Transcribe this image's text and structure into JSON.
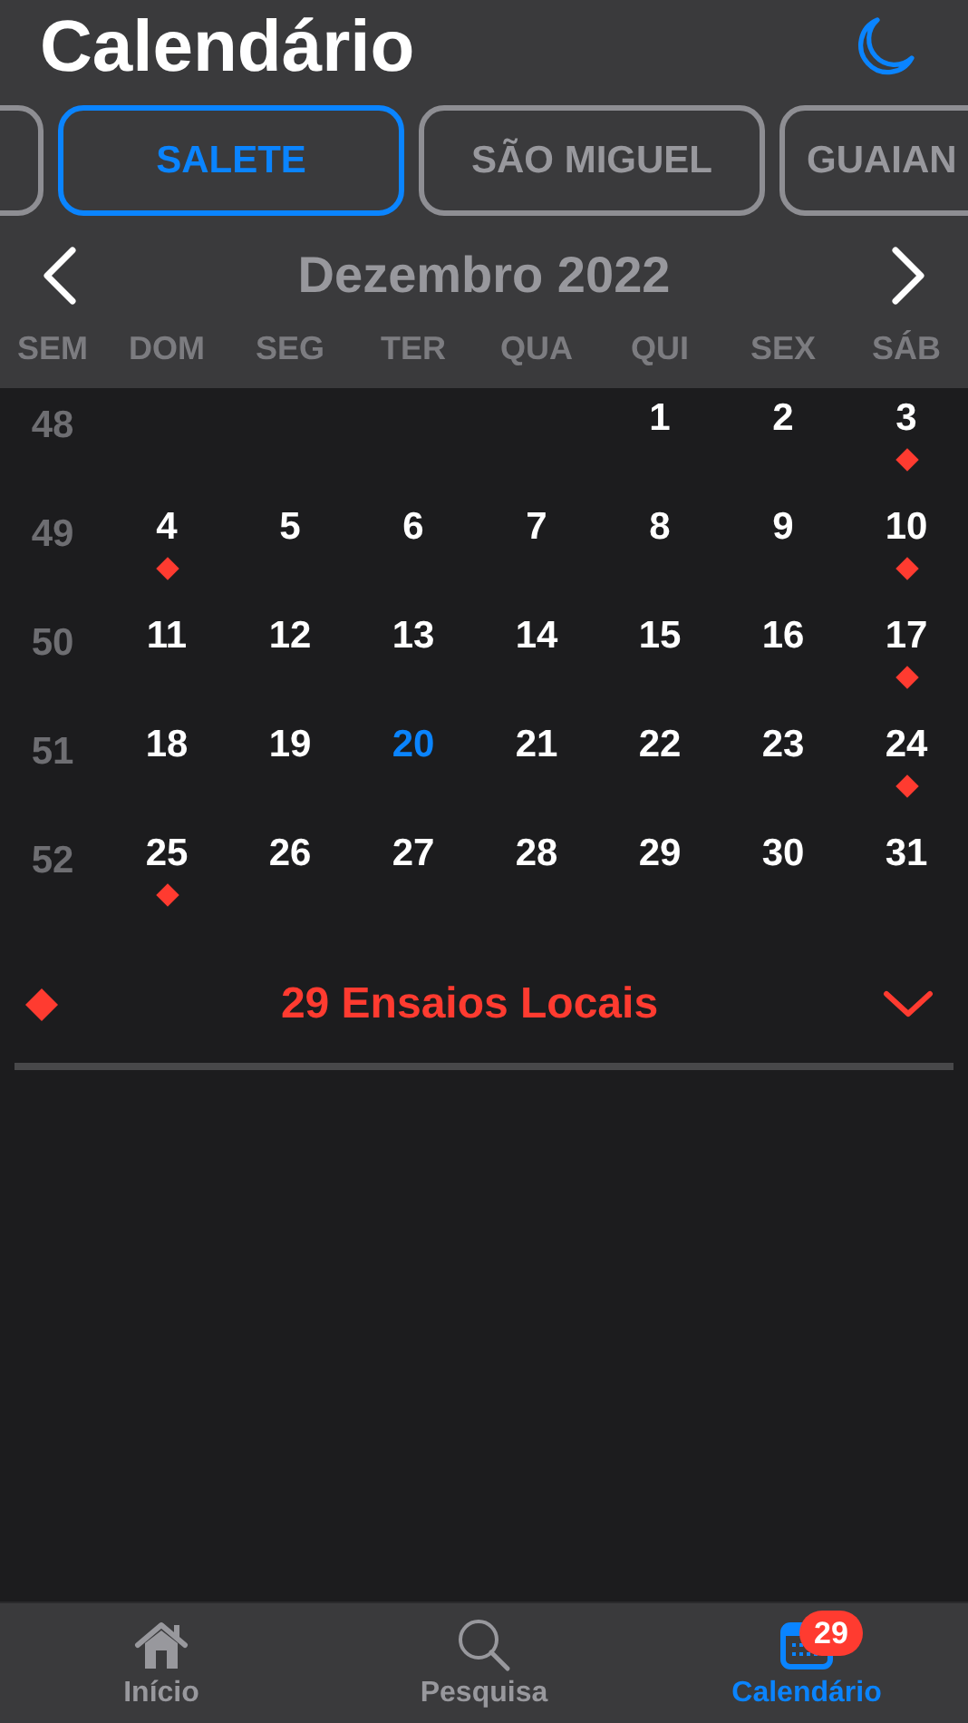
{
  "title": "Calendário",
  "chips": [
    {
      "kind": "partial",
      "selected": false
    },
    {
      "kind": "chip",
      "label": "SALETE",
      "selected": true
    },
    {
      "kind": "chip",
      "label": "SÃO MIGUEL",
      "selected": false
    },
    {
      "kind": "chip",
      "label": "GUAIAN",
      "selected": false
    }
  ],
  "month": "Dezembro 2022",
  "weekdays": [
    "SEM",
    "DOM",
    "SEG",
    "TER",
    "QUA",
    "QUI",
    "SEX",
    "SÁB"
  ],
  "weeks": [
    {
      "week": "48",
      "days": [
        {
          "kind": "blank"
        },
        {
          "kind": "blank"
        },
        {
          "kind": "blank"
        },
        {
          "kind": "blank"
        },
        {
          "kind": "day",
          "day": "1",
          "event": false,
          "today": false
        },
        {
          "kind": "day",
          "day": "2",
          "event": false,
          "today": false
        },
        {
          "kind": "day",
          "day": "3",
          "event": true,
          "today": false
        }
      ]
    },
    {
      "week": "49",
      "days": [
        {
          "kind": "day",
          "day": "4",
          "event": true,
          "today": false
        },
        {
          "kind": "day",
          "day": "5",
          "event": false,
          "today": false
        },
        {
          "kind": "day",
          "day": "6",
          "event": false,
          "today": false
        },
        {
          "kind": "day",
          "day": "7",
          "event": false,
          "today": false
        },
        {
          "kind": "day",
          "day": "8",
          "event": false,
          "today": false
        },
        {
          "kind": "day",
          "day": "9",
          "event": false,
          "today": false
        },
        {
          "kind": "day",
          "day": "10",
          "event": true,
          "today": false
        }
      ]
    },
    {
      "week": "50",
      "days": [
        {
          "kind": "day",
          "day": "11",
          "event": false,
          "today": false
        },
        {
          "kind": "day",
          "day": "12",
          "event": false,
          "today": false
        },
        {
          "kind": "day",
          "day": "13",
          "event": false,
          "today": false
        },
        {
          "kind": "day",
          "day": "14",
          "event": false,
          "today": false
        },
        {
          "kind": "day",
          "day": "15",
          "event": false,
          "today": false
        },
        {
          "kind": "day",
          "day": "16",
          "event": false,
          "today": false
        },
        {
          "kind": "day",
          "day": "17",
          "event": true,
          "today": false
        }
      ]
    },
    {
      "week": "51",
      "days": [
        {
          "kind": "day",
          "day": "18",
          "event": false,
          "today": false
        },
        {
          "kind": "day",
          "day": "19",
          "event": false,
          "today": false
        },
        {
          "kind": "day",
          "day": "20",
          "event": false,
          "today": true
        },
        {
          "kind": "day",
          "day": "21",
          "event": false,
          "today": false
        },
        {
          "kind": "day",
          "day": "22",
          "event": false,
          "today": false
        },
        {
          "kind": "day",
          "day": "23",
          "event": false,
          "today": false
        },
        {
          "kind": "day",
          "day": "24",
          "event": true,
          "today": false
        }
      ]
    },
    {
      "week": "52",
      "days": [
        {
          "kind": "day",
          "day": "25",
          "event": true,
          "today": false
        },
        {
          "kind": "day",
          "day": "26",
          "event": false,
          "today": false
        },
        {
          "kind": "day",
          "day": "27",
          "event": false,
          "today": false
        },
        {
          "kind": "day",
          "day": "28",
          "event": false,
          "today": false
        },
        {
          "kind": "day",
          "day": "29",
          "event": false,
          "today": false
        },
        {
          "kind": "day",
          "day": "30",
          "event": false,
          "today": false
        },
        {
          "kind": "day",
          "day": "31",
          "event": false,
          "today": false
        }
      ]
    }
  ],
  "events": {
    "label": "29 Ensaios Locais",
    "expanded": false
  },
  "tabbar": [
    {
      "kind": "home",
      "label": "Início",
      "selected": false
    },
    {
      "kind": "search",
      "label": "Pesquisa",
      "selected": false
    },
    {
      "kind": "calendar",
      "label": "Calendário",
      "selected": true,
      "badge": "29"
    }
  ]
}
